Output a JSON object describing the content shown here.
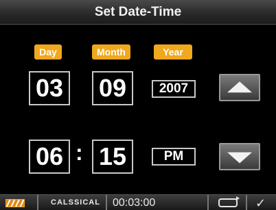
{
  "title": "Set Date-Time",
  "date": {
    "day_label": "Day",
    "month_label": "Month",
    "year_label": "Year",
    "day": "03",
    "month": "09",
    "year": "2007"
  },
  "time": {
    "hour": "06",
    "separator": ":",
    "minute": "15",
    "ampm": "PM"
  },
  "controls": {
    "up_icon": "up-arrow-icon",
    "down_icon": "down-arrow-icon"
  },
  "status": {
    "battery_icon": "battery-icon",
    "mode": "CALSSICAL",
    "elapsed": "00:03:00",
    "repeat_icon": "repeat-icon",
    "confirm_icon": "checkmark-icon"
  },
  "colors": {
    "accent": "#f0a81e",
    "background": "#000000",
    "border": "#c9c9c9"
  }
}
